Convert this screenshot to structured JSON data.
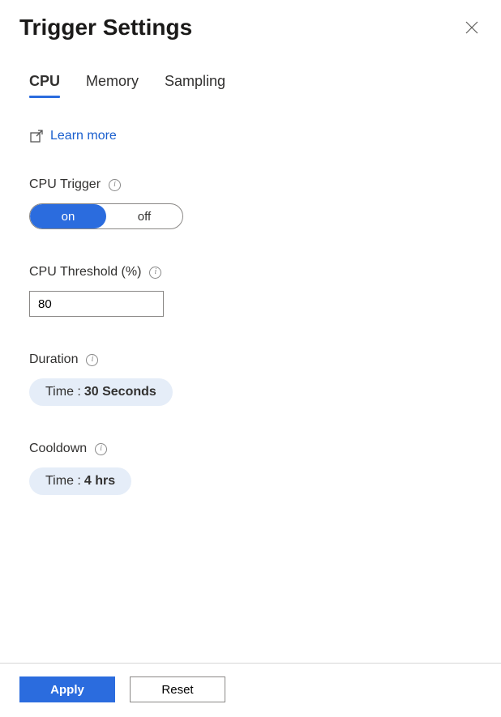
{
  "header": {
    "title": "Trigger Settings"
  },
  "tabs": {
    "cpu": "CPU",
    "memory": "Memory",
    "sampling": "Sampling"
  },
  "learn_more": "Learn more",
  "cpu_trigger": {
    "label": "CPU Trigger",
    "on": "on",
    "off": "off"
  },
  "cpu_threshold": {
    "label": "CPU Threshold (%)",
    "value": "80"
  },
  "duration": {
    "label": "Duration",
    "pill_label": "Time :",
    "pill_value": "30 Seconds"
  },
  "cooldown": {
    "label": "Cooldown",
    "pill_label": "Time :",
    "pill_value": "4 hrs"
  },
  "footer": {
    "apply": "Apply",
    "reset": "Reset"
  }
}
